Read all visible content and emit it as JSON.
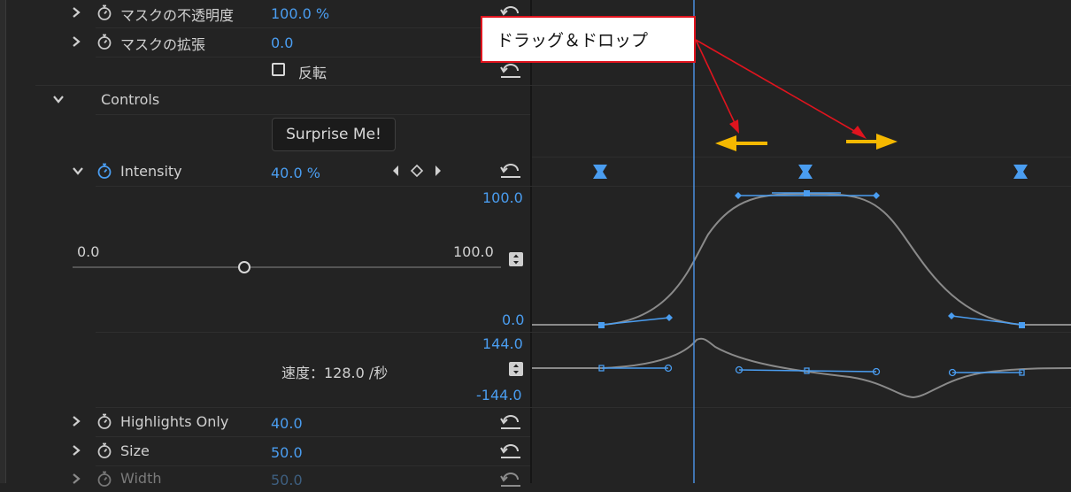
{
  "rows": {
    "mask_opacity": {
      "label": "マスクの不透明度",
      "value": "100.0 %"
    },
    "mask_expansion": {
      "label": "マスクの拡張",
      "value": "0.0"
    },
    "invert": {
      "label": "反転"
    },
    "controls_section": {
      "label": "Controls"
    },
    "surprise_button": {
      "label": "Surprise Me!"
    },
    "intensity": {
      "label": "Intensity",
      "value": "40.0 %"
    },
    "highlights_only": {
      "label": "Highlights Only",
      "value": "40.0"
    },
    "size": {
      "label": "Size",
      "value": "50.0"
    },
    "width": {
      "label": "Width",
      "value": "50.0"
    }
  },
  "slider": {
    "min_label": "0.0",
    "max_label": "100.0",
    "level": 0.4
  },
  "value_graph": {
    "max_label": "100.0",
    "min_label": "0.0"
  },
  "velocity_graph": {
    "max_label": "144.0",
    "min_label": "-144.0",
    "speed_text": "速度：128.0 /秒"
  },
  "annotation": {
    "text": "ドラッグ＆ドロップ"
  },
  "colors": {
    "accent": "#4a9df0",
    "arrow": "#f5b800",
    "callout_border": "#e0141e",
    "playhead": "#4a8fe0"
  }
}
